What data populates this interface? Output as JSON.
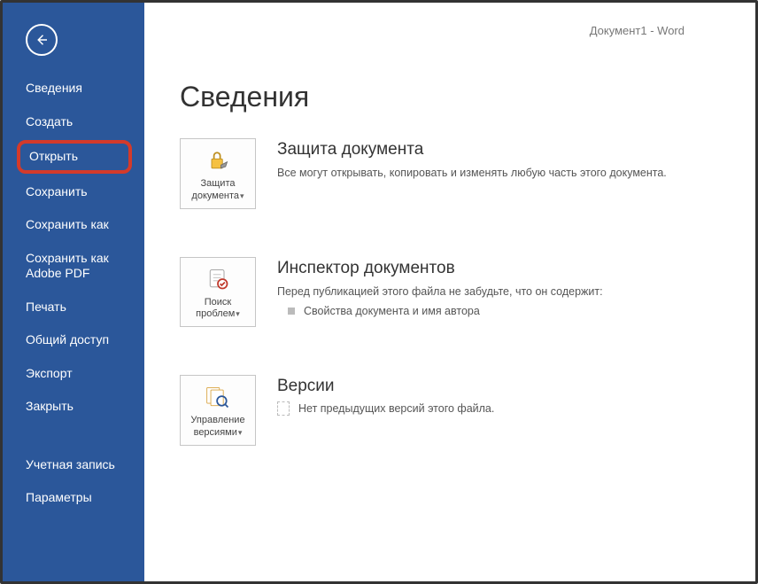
{
  "window_title": "Документ1 - Word",
  "sidebar": {
    "items": [
      {
        "label": "Сведения"
      },
      {
        "label": "Создать"
      },
      {
        "label": "Открыть"
      },
      {
        "label": "Сохранить"
      },
      {
        "label": "Сохранить как"
      },
      {
        "label": "Сохранить как Adobe PDF"
      },
      {
        "label": "Печать"
      },
      {
        "label": "Общий доступ"
      },
      {
        "label": "Экспорт"
      },
      {
        "label": "Закрыть"
      }
    ],
    "footer": [
      {
        "label": "Учетная запись"
      },
      {
        "label": "Параметры"
      }
    ]
  },
  "main": {
    "page_title": "Сведения",
    "protect": {
      "tile_label": "Защита документа",
      "title": "Защита документа",
      "desc": "Все могут открывать, копировать и изменять любую часть этого документа."
    },
    "inspect": {
      "tile_label": "Поиск проблем",
      "title": "Инспектор документов",
      "desc": "Перед публикацией этого файла не забудьте, что он содержит:",
      "bullet": "Свойства документа и имя автора"
    },
    "versions": {
      "tile_label": "Управление версиями",
      "title": "Версии",
      "desc": "Нет предыдущих версий этого файла."
    }
  }
}
